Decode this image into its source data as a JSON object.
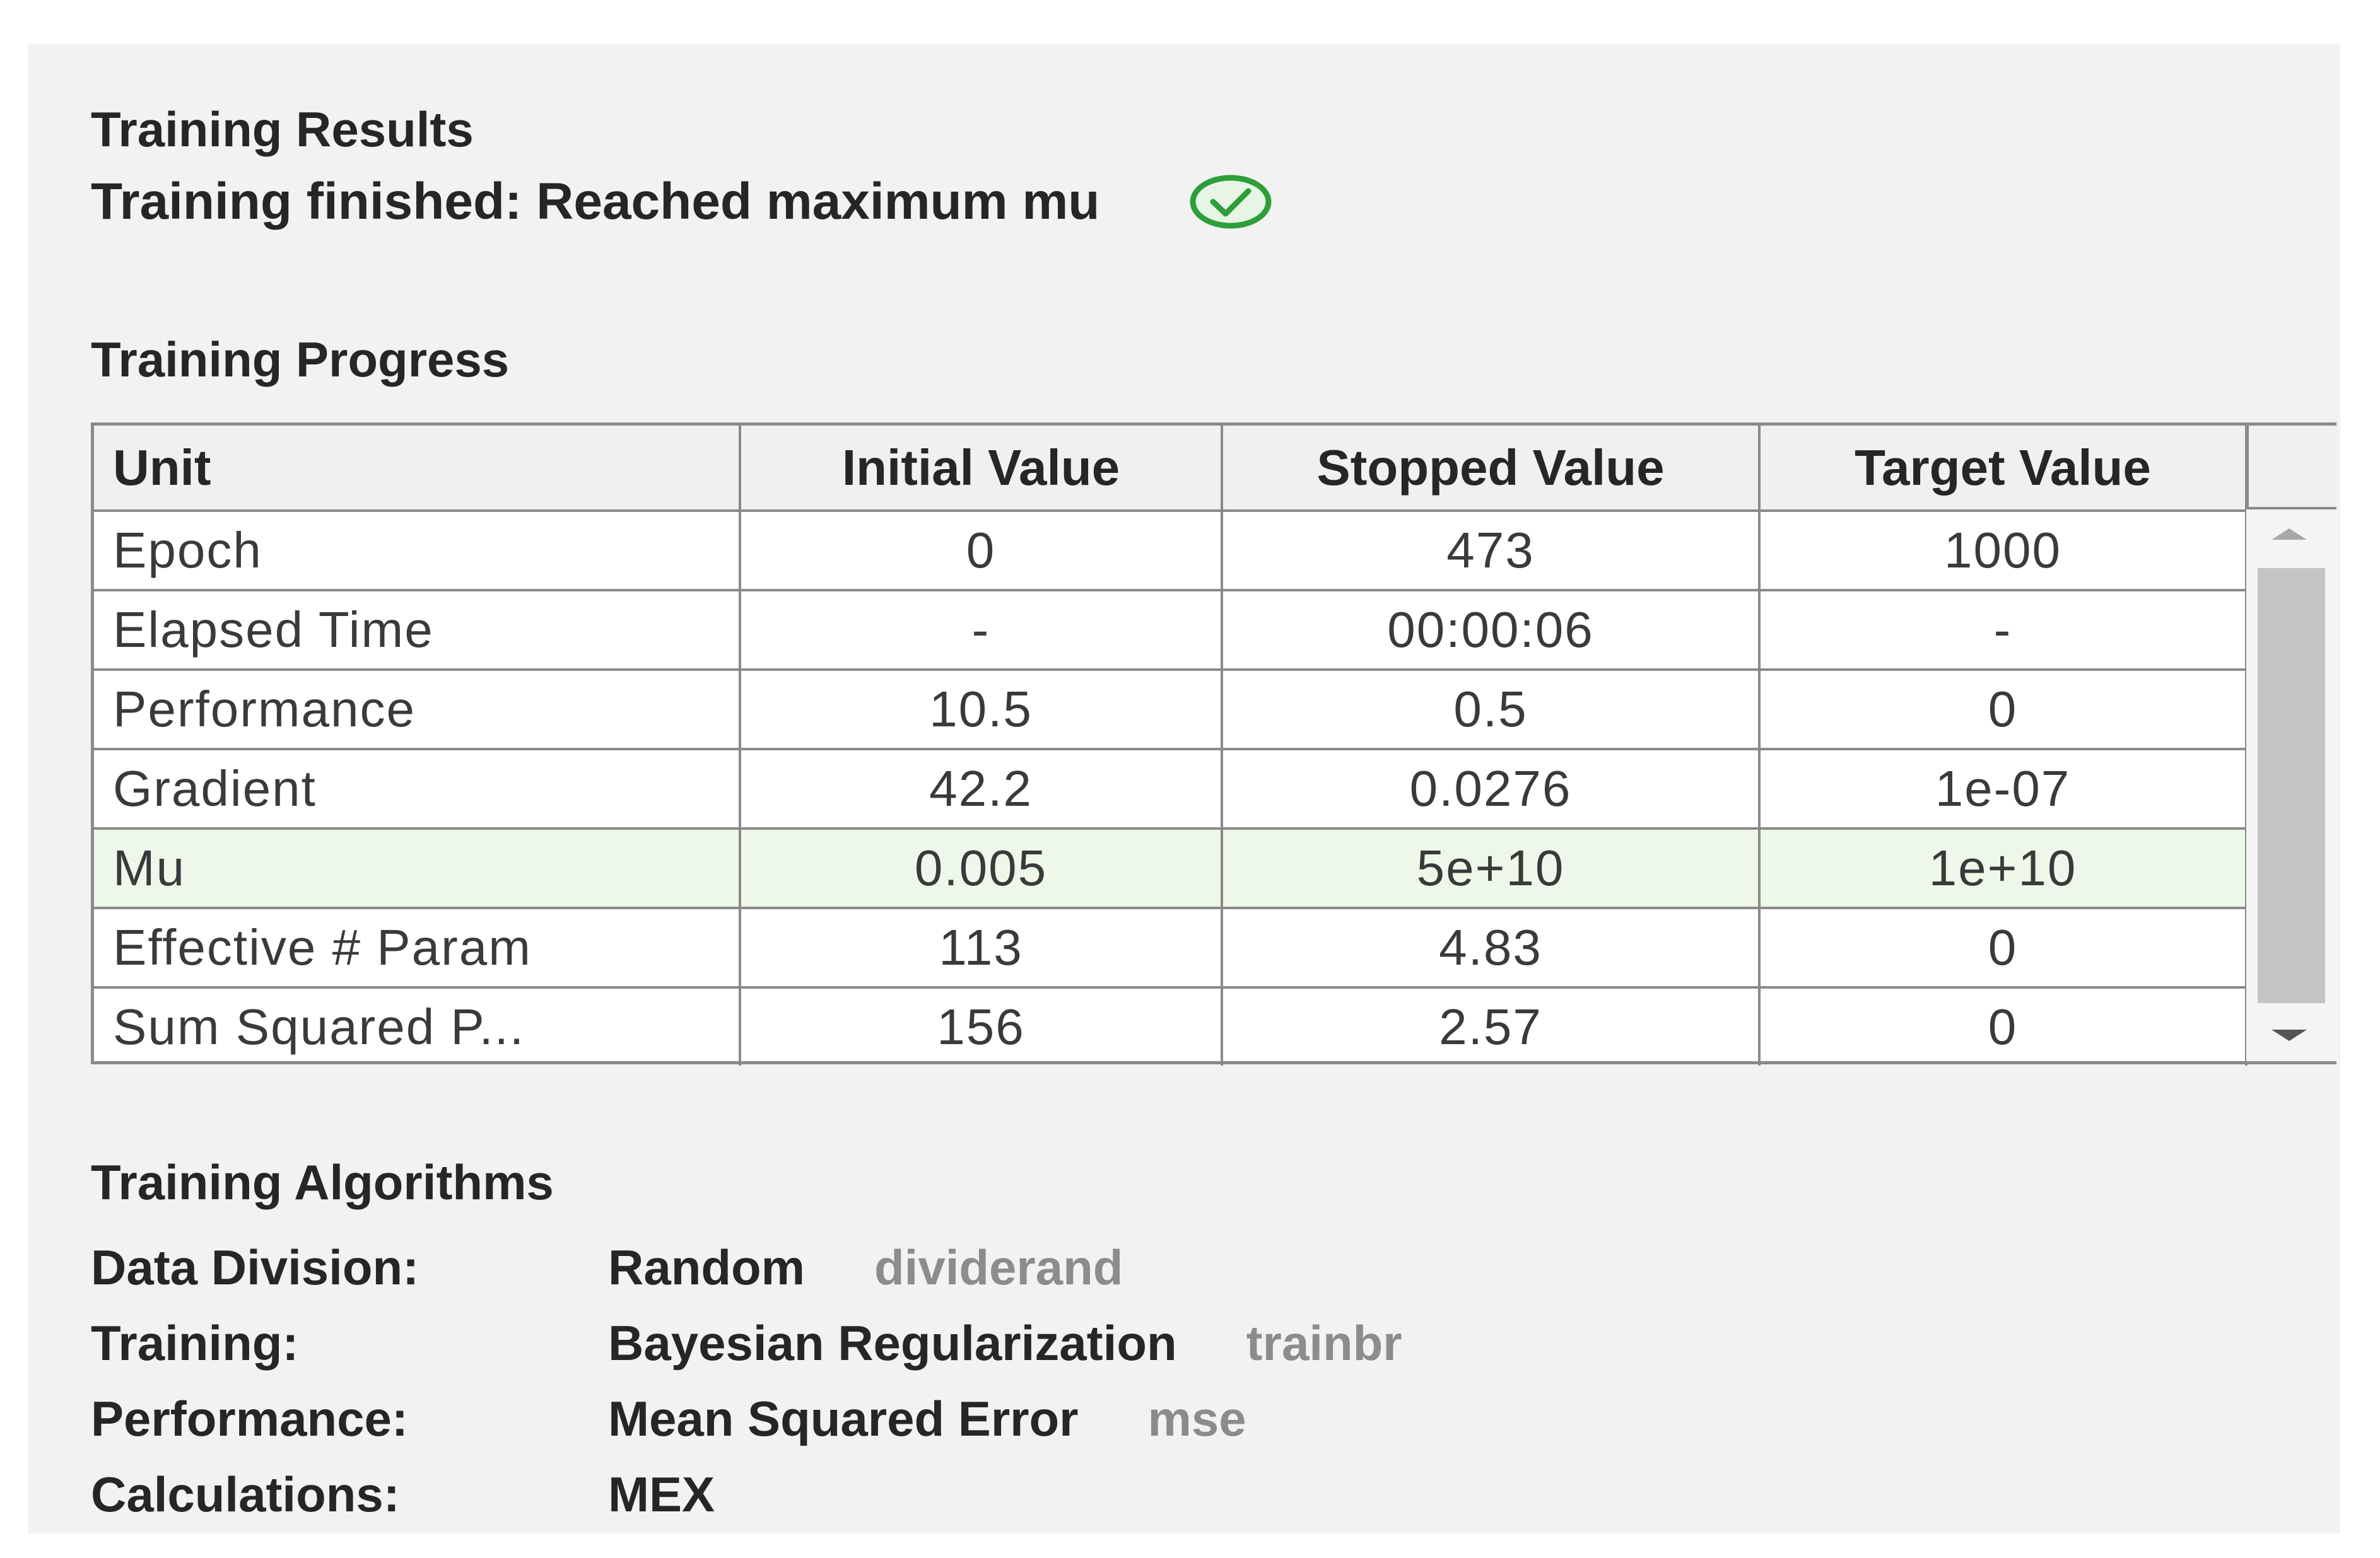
{
  "results": {
    "title": "Training Results",
    "status": "Training finished: Reached maximum mu",
    "status_icon": "check-circle-icon",
    "status_color": "#2e9e3a"
  },
  "progress": {
    "title": "Training Progress",
    "columns": [
      "Unit",
      "Initial Value",
      "Stopped Value",
      "Target Value"
    ],
    "rows": [
      {
        "unit": "Epoch",
        "initial": "0",
        "stopped": "473",
        "target": "1000"
      },
      {
        "unit": "Elapsed Time",
        "initial": "-",
        "stopped": "00:00:06",
        "target": "-"
      },
      {
        "unit": "Performance",
        "initial": "10.5",
        "stopped": "0.5",
        "target": "0"
      },
      {
        "unit": "Gradient",
        "initial": "42.2",
        "stopped": "0.0276",
        "target": "1e-07"
      },
      {
        "unit": "Mu",
        "initial": "0.005",
        "stopped": "5e+10",
        "target": "1e+10"
      },
      {
        "unit": "Effective # Param",
        "initial": "113",
        "stopped": "4.83",
        "target": "0"
      },
      {
        "unit": "Sum Squared P...",
        "initial": "156",
        "stopped": "2.57",
        "target": "0"
      }
    ],
    "highlight_color": "#eef8ea"
  },
  "algorithms": {
    "title": "Training Algorithms",
    "items": [
      {
        "label": "Data Division:",
        "value": "Random",
        "fn": "dividerand"
      },
      {
        "label": "Training:",
        "value": "Bayesian Regularization",
        "fn": "trainbr"
      },
      {
        "label": "Performance:",
        "value": "Mean Squared Error",
        "fn": "mse"
      },
      {
        "label": "Calculations:",
        "value": "MEX",
        "fn": ""
      }
    ]
  }
}
